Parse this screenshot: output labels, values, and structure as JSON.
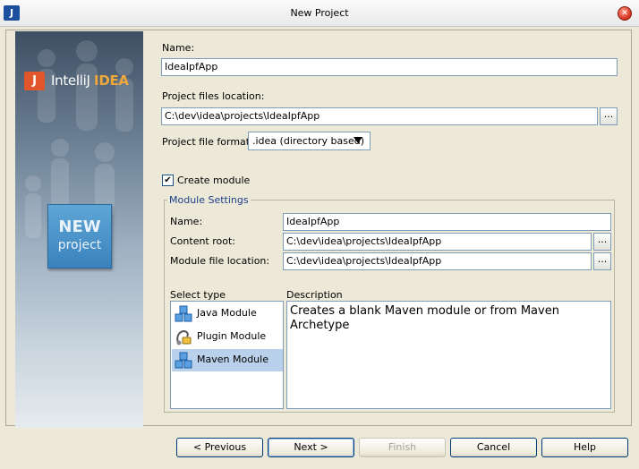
{
  "window": {
    "title": "New Project"
  },
  "banner": {
    "logo_mark": "J",
    "logo_intellij": "IntelliJ",
    "logo_idea": "IDEA",
    "badge_line1": "NEW",
    "badge_line2": "project"
  },
  "form": {
    "name_label": "Name:",
    "name_value": "IdeaIpfApp",
    "location_label": "Project files location:",
    "location_value": "C:\\dev\\idea\\projects\\IdeaIpfApp",
    "format_label": "Project file format:",
    "format_value": ".idea (directory based)",
    "create_module_label": "Create module",
    "create_module_checked": true
  },
  "module_settings": {
    "title": "Module Settings",
    "name_label": "Name:",
    "name_value": "IdeaIpfApp",
    "content_root_label": "Content root:",
    "content_root_value": "C:\\dev\\idea\\projects\\IdeaIpfApp",
    "module_file_label": "Module file location:",
    "module_file_value": "C:\\dev\\idea\\projects\\IdeaIpfApp",
    "select_type_label": "Select type",
    "description_label": "Description",
    "types": [
      {
        "label": "Java Module",
        "icon": "cubes-icon",
        "selected": false
      },
      {
        "label": "Plugin Module",
        "icon": "plug-icon",
        "selected": false
      },
      {
        "label": "Maven Module",
        "icon": "cubes-icon",
        "selected": true
      }
    ],
    "description": "Creates a blank Maven module or from Maven Archetype"
  },
  "buttons": {
    "previous": "< Previous",
    "next": "Next >",
    "finish": "Finish",
    "cancel": "Cancel",
    "help": "Help"
  },
  "browse_label": "..."
}
